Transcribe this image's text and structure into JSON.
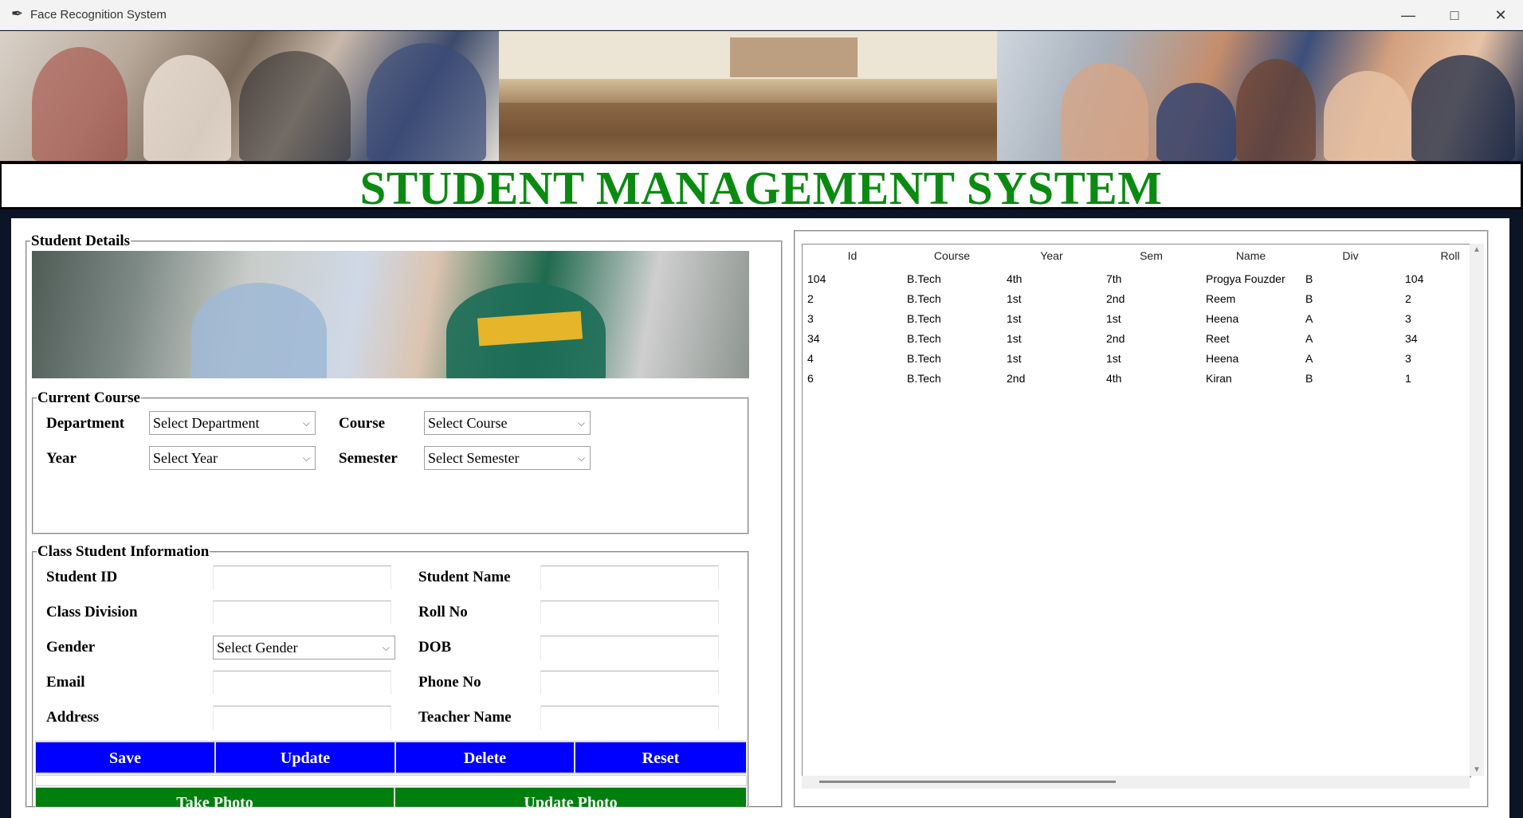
{
  "window": {
    "title": "Face Recognition System"
  },
  "heading": "STUDENT MANAGEMENT SYSTEM",
  "student_details": {
    "legend": "Student Details",
    "current_course": {
      "legend": "Current Course",
      "department_label": "Department",
      "department_value": "Select Department",
      "course_label": "Course",
      "course_value": "Select Course",
      "year_label": "Year",
      "year_value": "Select Year",
      "semester_label": "Semester",
      "semester_value": "Select Semester"
    },
    "class_info": {
      "legend": "Class Student Information",
      "student_id_label": "Student ID",
      "student_name_label": "Student Name",
      "class_division_label": "Class Division",
      "roll_no_label": "Roll No",
      "gender_label": "Gender",
      "gender_value": "Select Gender",
      "dob_label": "DOB",
      "email_label": "Email",
      "phone_label": "Phone No",
      "address_label": "Address",
      "teacher_label": "Teacher Name"
    },
    "buttons": {
      "save": "Save",
      "update": "Update",
      "delete": "Delete",
      "reset": "Reset",
      "take_photo": "Take Photo",
      "update_photo": "Update Photo"
    }
  },
  "table": {
    "columns": [
      "Id",
      "Course",
      "Year",
      "Sem",
      "Name",
      "Div",
      "Roll"
    ],
    "rows": [
      [
        "104",
        "B.Tech",
        "4th",
        "7th",
        "Progya Fouzder",
        "B",
        "104"
      ],
      [
        "2",
        "B.Tech",
        "1st",
        "2nd",
        "Reem",
        "B",
        "2"
      ],
      [
        "3",
        "B.Tech",
        "1st",
        "1st",
        "Heena",
        "A",
        "3"
      ],
      [
        "34",
        "B.Tech",
        "1st",
        "2nd",
        "Reet",
        "A",
        "34"
      ],
      [
        "4",
        "B.Tech",
        "1st",
        "1st",
        "Heena",
        "A",
        "3"
      ],
      [
        "6",
        "B.Tech",
        "2nd",
        "4th",
        "Kiran",
        "B",
        "1"
      ]
    ]
  },
  "colors": {
    "heading": "#0b8a12",
    "blue_button": "#0000fe",
    "green_button": "#007f0e"
  }
}
